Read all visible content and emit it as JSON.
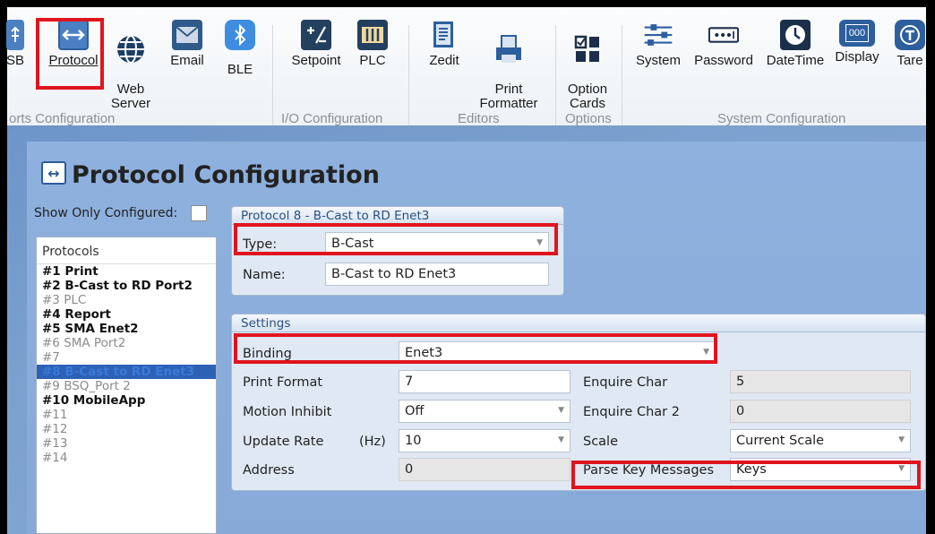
{
  "ribbon": {
    "items": [
      {
        "label": "SB",
        "icon": "usb-icon"
      },
      {
        "label": "Protocol",
        "icon": "protocol-arrows-icon"
      },
      {
        "label": "Web\nServer",
        "icon": "globe-icon"
      },
      {
        "label": "Email",
        "icon": "envelope-icon"
      },
      {
        "label": "BLE",
        "icon": "bluetooth-icon"
      },
      {
        "label": "Setpoint",
        "icon": "setpoint-icon"
      },
      {
        "label": "PLC",
        "icon": "plc-icon"
      },
      {
        "label": "Zedit",
        "icon": "zedit-icon"
      },
      {
        "label": "Print\nFormatter",
        "icon": "print-formatter-icon"
      },
      {
        "label": "Option\nCards",
        "icon": "option-cards-icon"
      },
      {
        "label": "System",
        "icon": "sliders-icon"
      },
      {
        "label": "Password",
        "icon": "password-icon"
      },
      {
        "label": "DateTime",
        "icon": "clock-icon"
      },
      {
        "label": "Display",
        "icon": "display-icon"
      },
      {
        "label": "Tare",
        "icon": "tare-icon"
      }
    ],
    "groups": {
      "ports": "orts Configuration",
      "io": "I/O Configuration",
      "editors": "Editors",
      "options": "Options",
      "system": "System Configuration"
    },
    "display_icon_text": "000"
  },
  "page": {
    "title": "Protocol Configuration",
    "show_only_label": "Show Only Configured:"
  },
  "protocols": {
    "header": "Protocols",
    "items": [
      {
        "label": "#1 Print",
        "state": "configured"
      },
      {
        "label": "#2 B-Cast to RD Port2",
        "state": "configured"
      },
      {
        "label": "#3 PLC",
        "state": "unconf"
      },
      {
        "label": "#4 Report",
        "state": "configured"
      },
      {
        "label": "#5 SMA Enet2",
        "state": "configured"
      },
      {
        "label": "#6 SMA Port2",
        "state": "unconf"
      },
      {
        "label": "#7",
        "state": "unconf"
      },
      {
        "label": "#8 B-Cast to RD Enet3",
        "state": "selected"
      },
      {
        "label": "#9 BSQ_Port 2",
        "state": "unconf"
      },
      {
        "label": "#10 MobileApp",
        "state": "configured"
      },
      {
        "label": "#11",
        "state": "unconf"
      },
      {
        "label": "#12",
        "state": "unconf"
      },
      {
        "label": "#13",
        "state": "unconf"
      },
      {
        "label": "#14",
        "state": "unconf"
      }
    ]
  },
  "protocol_box": {
    "header": "Protocol 8 - B-Cast to RD Enet3",
    "type_label": "Type:",
    "type_value": "B-Cast",
    "name_label": "Name:",
    "name_value": "B-Cast to RD Enet3"
  },
  "settings": {
    "header": "Settings",
    "binding_label": "Binding",
    "binding_value": "Enet3",
    "print_format_label": "Print Format",
    "print_format_value": "7",
    "motion_inhibit_label": "Motion Inhibit",
    "motion_inhibit_value": "Off",
    "update_rate_label": "Update Rate",
    "update_rate_unit": "(Hz)",
    "update_rate_value": "10",
    "address_label": "Address",
    "address_value": "0",
    "enquire_char_label": "Enquire Char",
    "enquire_char_value": "5",
    "enquire_char2_label": "Enquire Char 2",
    "enquire_char2_value": "0",
    "scale_label": "Scale",
    "scale_value": "Current Scale",
    "parse_key_label": "Parse Key Messages",
    "parse_key_value": "Keys"
  },
  "colors": {
    "highlight": "#e0141e",
    "selected_row": "#2d61b5",
    "panel_bg": "#87a9d8"
  }
}
